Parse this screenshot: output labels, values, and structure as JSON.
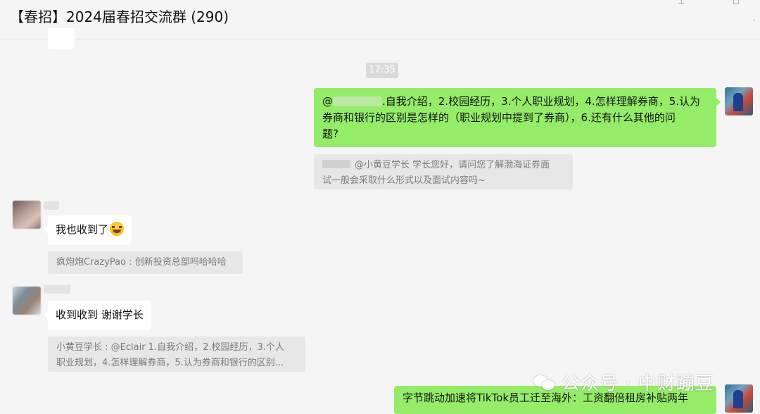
{
  "window": {
    "title": "【春招】2024届春招交流群 (290)"
  },
  "messages": {
    "time_separator": "17:35",
    "m1": {
      "prefix": "@",
      "text_line1": ".自我介绍，2.校园经历，3.个人职业规划，4.怎样理解券商，5.认为",
      "text_line2": "券商和银行的区别是怎样的（职业规划中提到了券商），6.还有什么其他的问",
      "text_line3": "题?",
      "quote_line1": "@小黄豆学长 学长您好，请问您了解渤海证券面",
      "quote_line2": "试一般会采取什么形式以及面试内容吗~"
    },
    "m2": {
      "text": "我也收到了",
      "quote": "疯炮炮CrazyPao : 创新投资总部吗哈哈哈"
    },
    "m3": {
      "text": "收到收到 谢谢学长",
      "quote_line1": "小黄豆学长 : @Eclair 1.自我介绍，2.校园经历，3.个人",
      "quote_line2": "职业规划，4.怎样理解券商，5.认为券商和银行的区别..."
    },
    "m4": {
      "text": "字节跳动加速将TikTok员工迁至海外：工资翻倍租房补贴两年"
    }
  },
  "watermark": {
    "text": "公众号 · 中财蹦豆"
  },
  "colors": {
    "background": "#f5f5f5",
    "sent_bubble": "#95ec69",
    "received_bubble": "#ffffff",
    "quote_background": "#e7e7e7"
  }
}
